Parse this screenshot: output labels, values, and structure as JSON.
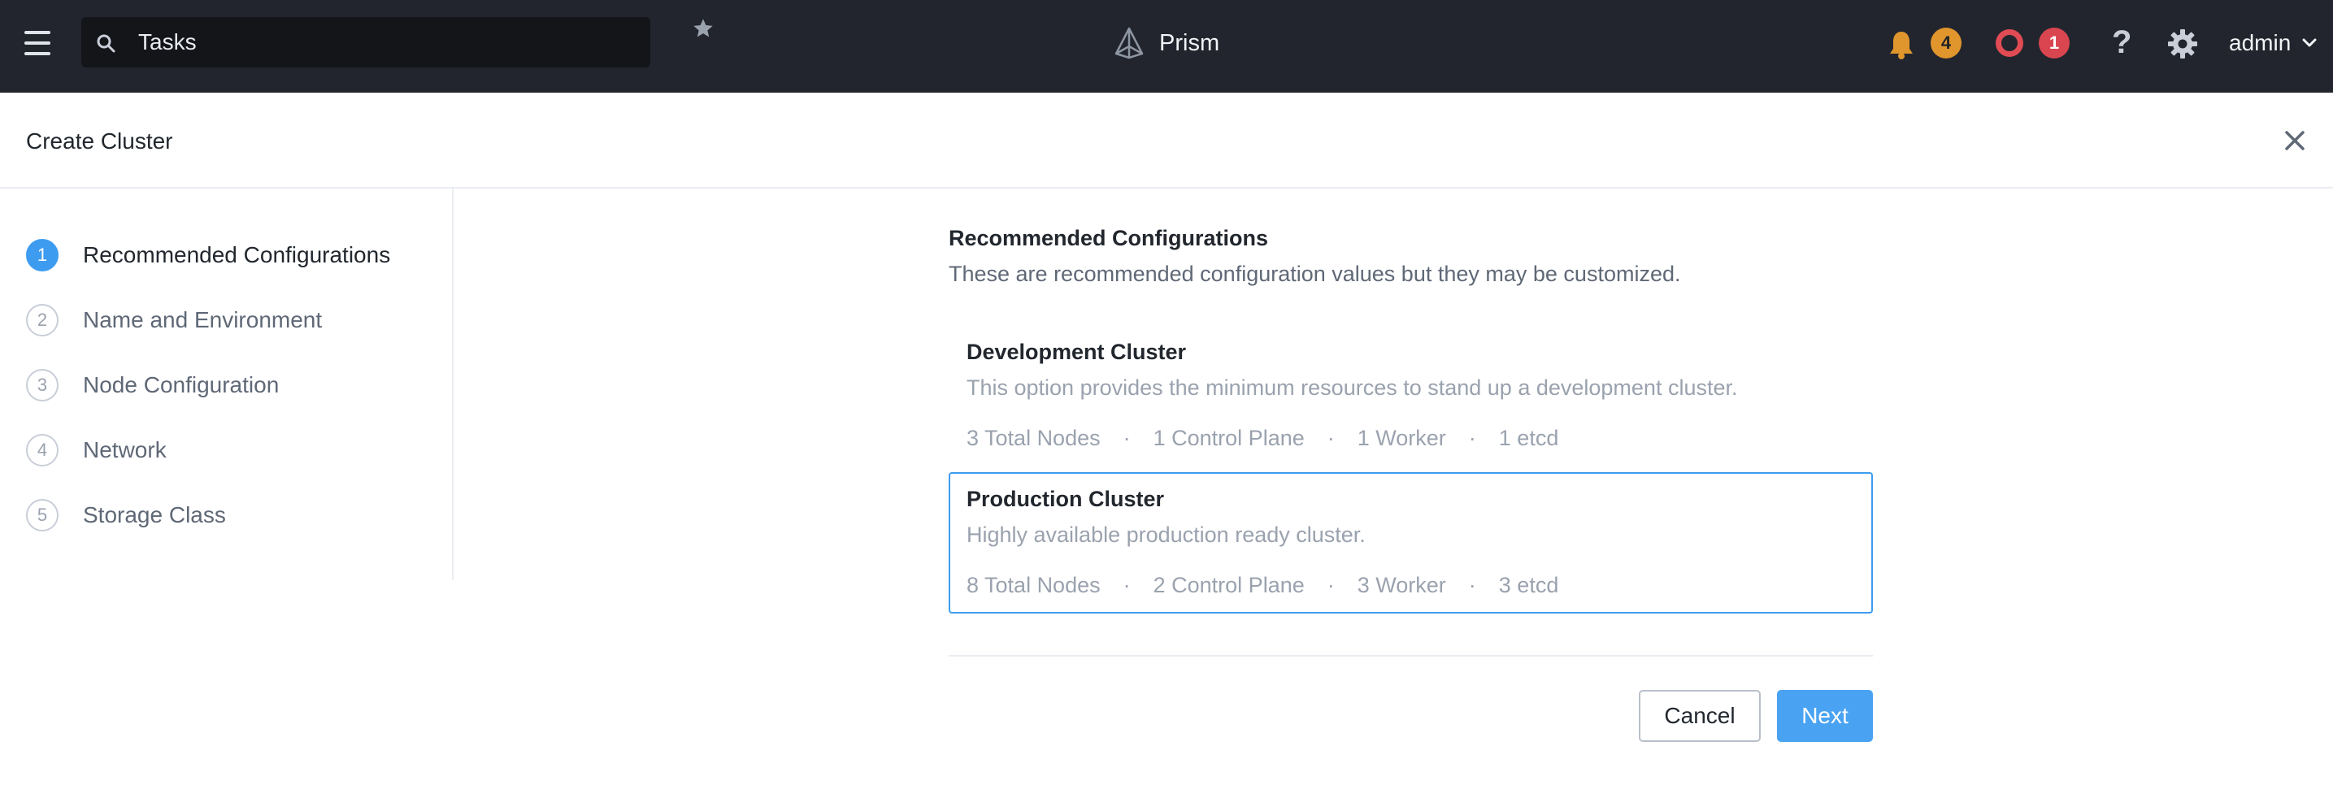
{
  "colors": {
    "topbar_bg": "#22252d",
    "search_bg": "#131519",
    "accent": "#3d9cf0",
    "notification_badge": "#e0962c",
    "alert_badge": "#d94650"
  },
  "topbar": {
    "menu_icon": "hamburger-icon",
    "search": {
      "icon": "search-icon",
      "value": "Tasks",
      "favorite_icon": "star-icon"
    },
    "brand": {
      "logo_icon": "prism-logo-icon",
      "name": "Prism"
    },
    "notifications": {
      "icon": "bell-icon",
      "count": "4"
    },
    "alerts": {
      "icon": "alert-circle-icon",
      "count": "1"
    },
    "help_icon": "question-icon",
    "help_glyph": "?",
    "settings_icon": "gear-icon",
    "user": {
      "name": "admin",
      "icon": "chevron-down-icon"
    }
  },
  "header": {
    "title": "Create Cluster",
    "close_icon": "close-icon"
  },
  "wizard": {
    "steps": [
      {
        "number": "1",
        "label": "Recommended Configurations",
        "active": true
      },
      {
        "number": "2",
        "label": "Name and Environment",
        "active": false
      },
      {
        "number": "3",
        "label": "Node Configuration",
        "active": false
      },
      {
        "number": "4",
        "label": "Network",
        "active": false
      },
      {
        "number": "5",
        "label": "Storage Class",
        "active": false
      }
    ]
  },
  "main": {
    "title": "Recommended Configurations",
    "description": "These are recommended configuration values but they may be customized.",
    "separator": "·",
    "options": [
      {
        "title": "Development Cluster",
        "description": "This option provides the minimum resources to stand up a development cluster.",
        "selected": false,
        "specs": [
          "3 Total Nodes",
          "1 Control Plane",
          "1 Worker",
          "1 etcd"
        ]
      },
      {
        "title": "Production Cluster",
        "description": "Highly available production ready cluster.",
        "selected": true,
        "specs": [
          "8 Total Nodes",
          "2 Control Plane",
          "3 Worker",
          "3 etcd"
        ]
      }
    ]
  },
  "footer": {
    "cancel_label": "Cancel",
    "next_label": "Next"
  }
}
